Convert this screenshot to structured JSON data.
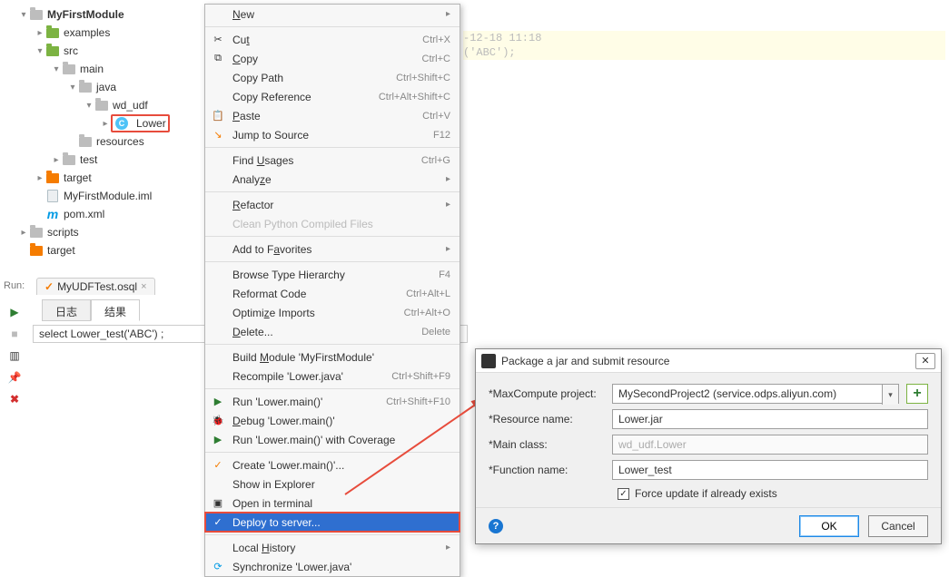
{
  "tree": {
    "root": "MyFirstModule",
    "items": [
      "examples",
      "src",
      "main",
      "java",
      "wd_udf",
      "Lower",
      "resources",
      "test",
      "target",
      "MyFirstModule.iml",
      "pom.xml",
      "scripts",
      "target"
    ]
  },
  "editor": {
    "line1": "-12-18 11:18",
    "line2": "('ABC');"
  },
  "run": {
    "label": "Run:",
    "tab": "MyUDFTest.osql",
    "subtabs": [
      "日志",
      "结果"
    ],
    "sql": "select Lower_test('ABC') ;"
  },
  "ctx": {
    "new": "New",
    "cut": "Cut",
    "cut_k": "Ctrl+X",
    "copy": "Copy",
    "copy_k": "Ctrl+C",
    "copypath": "Copy Path",
    "copypath_k": "Ctrl+Shift+C",
    "copyref": "Copy Reference",
    "copyref_k": "Ctrl+Alt+Shift+C",
    "paste": "Paste",
    "paste_k": "Ctrl+V",
    "jump": "Jump to Source",
    "jump_k": "F12",
    "findusages": "Find Usages",
    "findusages_k": "Ctrl+G",
    "analyze": "Analyze",
    "refactor": "Refactor",
    "cleanpy": "Clean Python Compiled Files",
    "addfav": "Add to Favorites",
    "browsehier": "Browse Type Hierarchy",
    "browsehier_k": "F4",
    "reformat": "Reformat Code",
    "reformat_k": "Ctrl+Alt+L",
    "optimports": "Optimize Imports",
    "optimports_k": "Ctrl+Alt+O",
    "delete": "Delete...",
    "delete_k": "Delete",
    "buildmod": "Build Module 'MyFirstModule'",
    "recompile": "Recompile 'Lower.java'",
    "recompile_k": "Ctrl+Shift+F9",
    "run1": "Run 'Lower.main()'",
    "run1_k": "Ctrl+Shift+F10",
    "debug": "Debug 'Lower.main()'",
    "runcov": "Run 'Lower.main()' with Coverage",
    "create": "Create 'Lower.main()'...",
    "showexp": "Show in Explorer",
    "openterm": "Open in terminal",
    "deploy": "Deploy to server...",
    "localhist": "Local History",
    "sync": "Synchronize 'Lower.java'"
  },
  "dlg": {
    "title": "Package a jar and submit resource",
    "proj_label": "*MaxCompute project:",
    "proj_value": "MySecondProject2 (service.odps.aliyun.com)",
    "res_label": "*Resource name:",
    "res_value": "Lower.jar",
    "main_label": "*Main class:",
    "main_value": "wd_udf.Lower",
    "func_label": "*Function name:",
    "func_value": "Lower_test",
    "force": "Force update if already exists",
    "ok": "OK",
    "cancel": "Cancel"
  }
}
